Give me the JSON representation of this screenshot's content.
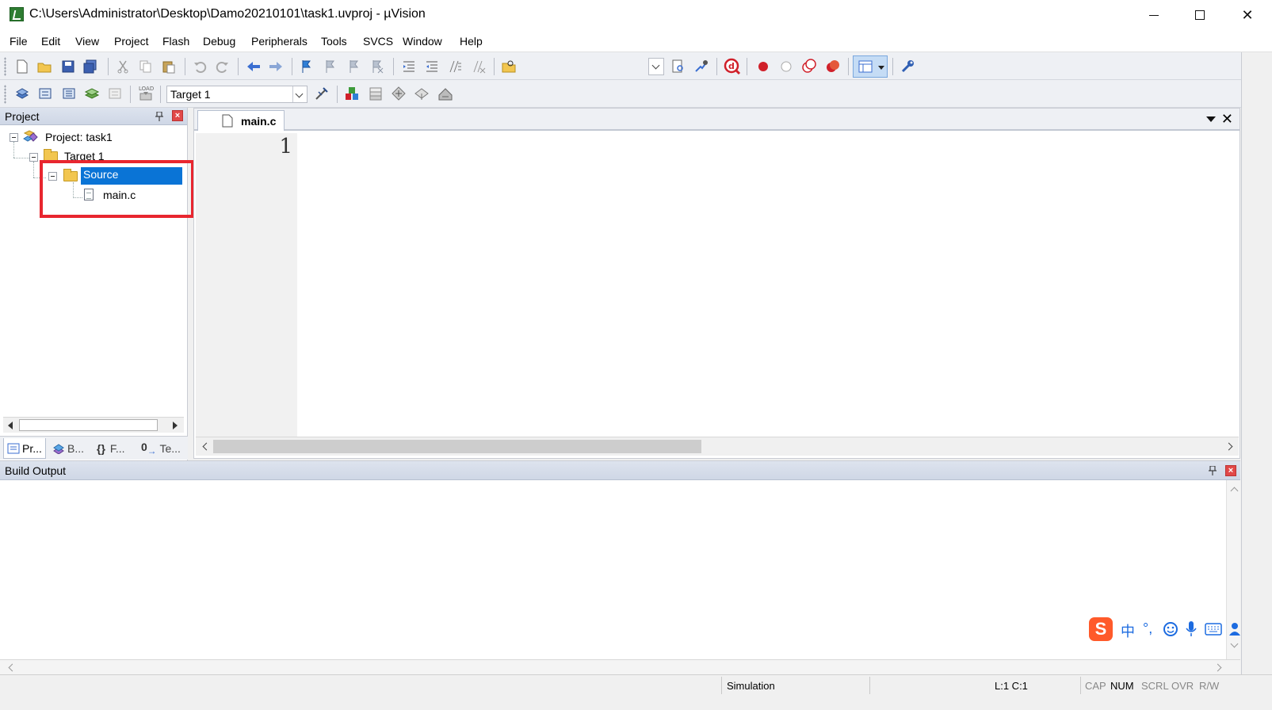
{
  "window": {
    "title": "C:\\Users\\Administrator\\Desktop\\Damo20210101\\task1.uvproj - µVision"
  },
  "menu": [
    "File",
    "Edit",
    "View",
    "Project",
    "Flash",
    "Debug",
    "Peripherals",
    "Tools",
    "SVCS",
    "Window",
    "Help"
  ],
  "toolbar2": {
    "target_value": "Target 1"
  },
  "project_panel": {
    "title": "Project",
    "tree": {
      "project": "Project: task1",
      "target": "Target 1",
      "group": "Source",
      "file": "main.c"
    },
    "tabs": [
      "Pr...",
      "B...",
      "F...",
      "Te..."
    ]
  },
  "editor": {
    "active_tab": "main.c",
    "line_numbers": [
      "1"
    ]
  },
  "build_output": {
    "title": "Build Output"
  },
  "ime": {
    "items": [
      "中",
      "°,"
    ]
  },
  "statusbar": {
    "mode": "Simulation",
    "position": "L:1 C:1",
    "keys": [
      {
        "label": "CAP",
        "on": false
      },
      {
        "label": "NUM",
        "on": true
      },
      {
        "label": "SCRL",
        "on": false
      },
      {
        "label": "OVR",
        "on": false
      },
      {
        "label": "R/W",
        "on": false
      }
    ]
  },
  "colors": {
    "selection": "#0a74d6",
    "highlight_box": "#e8262f",
    "panel_header": "#cfd7e6"
  }
}
